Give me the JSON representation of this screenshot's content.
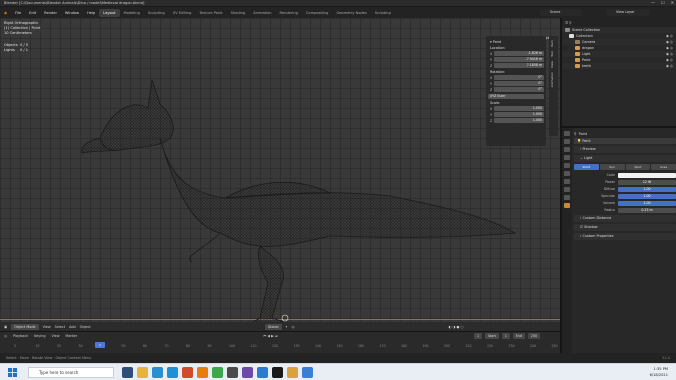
{
  "window": {
    "title": "Blender [C:\\Documents\\Blender Animals\\Dino / model\\Medieval dragon.blend]",
    "controls": [
      "—",
      "☐",
      "✕"
    ]
  },
  "menu": [
    "File",
    "Edit",
    "Render",
    "Window",
    "Help"
  ],
  "workspaces": [
    "Layout",
    "Modeling",
    "Sculpting",
    "UV Editing",
    "Texture Paint",
    "Shading",
    "Animation",
    "Rendering",
    "Compositing",
    "Geometry Nodes",
    "Scripting"
  ],
  "scene": "Scene",
  "view_layer": "View Layer",
  "viewport": {
    "overlay_lines": [
      "Right Orthographic",
      "(1) Collection | Point",
      "10 Centimeters"
    ],
    "stats": [
      [
        "Objects",
        "0 / 5"
      ],
      [
        "Lights",
        "0 / 1"
      ]
    ],
    "options": "Options"
  },
  "npanel": {
    "object_name": "Point",
    "location_label": "Location:",
    "location": [
      [
        "X",
        "-1.626 m"
      ],
      [
        "Y",
        "-7.9416 m"
      ],
      [
        "Z",
        "7.1858 m"
      ]
    ],
    "rotation_label": "Rotation:",
    "rotation": [
      [
        "X",
        "0°"
      ],
      [
        "Y",
        "0°"
      ],
      [
        "Z",
        "0°"
      ]
    ],
    "rotation_mode": "XYZ Euler",
    "scale_label": "Scale:",
    "scale": [
      [
        "X",
        "1.000"
      ],
      [
        "Y",
        "1.000"
      ],
      [
        "Z",
        "1.000"
      ]
    ],
    "tabs": [
      "Item",
      "Tool",
      "View",
      "Animation"
    ]
  },
  "toolbar": {
    "mode": "Object Mode",
    "menus": [
      "View",
      "Select",
      "Add",
      "Object"
    ],
    "transform": "Global"
  },
  "timeline": {
    "menus": [
      "Playback",
      "Keying",
      "View",
      "Marker"
    ],
    "current_frame": "1",
    "start_label": "Start",
    "start": "1",
    "end_label": "End",
    "end": "250",
    "ticks": [
      "0",
      "10",
      "20",
      "30",
      "40",
      "50",
      "60",
      "70",
      "80",
      "90",
      "100",
      "110",
      "120",
      "130",
      "140",
      "150",
      "160",
      "170",
      "180",
      "190",
      "200",
      "210",
      "220",
      "230",
      "240",
      "250"
    ]
  },
  "statusbar": {
    "text": "Select  ·  Move  ·  Rotate View  ·  Object Context Menu",
    "version": "3.1.0"
  },
  "outliner": {
    "header": "Scene Collection",
    "rows": [
      {
        "label": "Collection",
        "icon_color": "#e0e0e0"
      },
      {
        "label": "Camera",
        "icon_color": "#9b7c5a"
      },
      {
        "label": "dragon",
        "icon_color": "#d89b4a"
      },
      {
        "label": "Light",
        "icon_color": "#d89b4a"
      },
      {
        "label": "Point",
        "icon_color": "#d89b4a"
      },
      {
        "label": "teeth",
        "icon_color": "#d89b4a"
      }
    ]
  },
  "props": {
    "crumb": "Point",
    "object_name": "Point",
    "preview": "Preview",
    "light": "Light",
    "light_types": [
      "Point",
      "Sun",
      "Spot",
      "Area"
    ],
    "rows": [
      {
        "label": "Color",
        "value": "",
        "style": "white"
      },
      {
        "label": "Power",
        "value": "12 W",
        "style": "grey"
      },
      {
        "label": "Diffuse",
        "value": "1.00",
        "style": "blue"
      },
      {
        "label": "Specular",
        "value": "1.00",
        "style": "blue"
      },
      {
        "label": "Volume",
        "value": "1.00",
        "style": "blue"
      },
      {
        "label": "Radius",
        "value": "0.25 m",
        "style": "grey"
      }
    ],
    "custom_distance": "Custom Distance",
    "shadow": "Shadow",
    "custom_props": "Custom Properties"
  },
  "taskbar": {
    "search": "Type here to search",
    "time": "1:35 PM",
    "date": "6/18/2021"
  },
  "colors": {
    "accent": "#4670c4",
    "orange": "#c98a3c",
    "viewport": "#393939"
  }
}
